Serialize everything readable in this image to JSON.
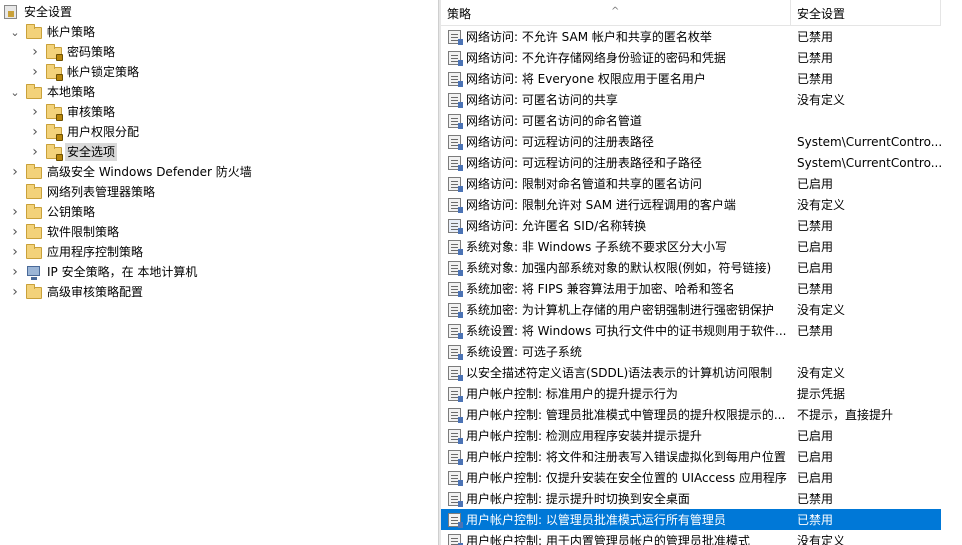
{
  "tree": {
    "root": {
      "label": "安全设置"
    },
    "items": [
      {
        "label": "帐户策略",
        "level": 1,
        "expander": "collapse",
        "icon": "folder"
      },
      {
        "label": "密码策略",
        "level": 2,
        "expander": "expand",
        "icon": "folder-lock"
      },
      {
        "label": "帐户锁定策略",
        "level": 2,
        "expander": "expand",
        "icon": "folder-lock"
      },
      {
        "label": "本地策略",
        "level": 1,
        "expander": "collapse",
        "icon": "folder"
      },
      {
        "label": "审核策略",
        "level": 2,
        "expander": "expand",
        "icon": "folder-lock"
      },
      {
        "label": "用户权限分配",
        "level": 2,
        "expander": "expand",
        "icon": "folder-lock"
      },
      {
        "label": "安全选项",
        "level": 2,
        "expander": "expand",
        "icon": "folder-lock",
        "selected": true
      },
      {
        "label": "高级安全 Windows Defender 防火墙",
        "level": 1,
        "expander": "expand",
        "icon": "folder"
      },
      {
        "label": "网络列表管理器策略",
        "level": 1,
        "expander": "none",
        "icon": "folder"
      },
      {
        "label": "公钥策略",
        "level": 1,
        "expander": "expand",
        "icon": "folder"
      },
      {
        "label": "软件限制策略",
        "level": 1,
        "expander": "expand",
        "icon": "folder"
      },
      {
        "label": "应用程序控制策略",
        "level": 1,
        "expander": "expand",
        "icon": "folder"
      },
      {
        "label": "IP 安全策略，在 本地计算机",
        "level": 1,
        "expander": "expand",
        "icon": "computer"
      },
      {
        "label": "高级审核策略配置",
        "level": 1,
        "expander": "expand",
        "icon": "folder"
      }
    ]
  },
  "list": {
    "columns": {
      "policy": "策略",
      "setting": "安全设置"
    },
    "rows": [
      {
        "policy": "网络访问: 不允许 SAM 帐户和共享的匿名枚举",
        "setting": "已禁用"
      },
      {
        "policy": "网络访问: 不允许存储网络身份验证的密码和凭据",
        "setting": "已禁用"
      },
      {
        "policy": "网络访问: 将 Everyone 权限应用于匿名用户",
        "setting": "已禁用"
      },
      {
        "policy": "网络访问: 可匿名访问的共享",
        "setting": "没有定义"
      },
      {
        "policy": "网络访问: 可匿名访问的命名管道",
        "setting": ""
      },
      {
        "policy": "网络访问: 可远程访问的注册表路径",
        "setting": "System\\CurrentContro..."
      },
      {
        "policy": "网络访问: 可远程访问的注册表路径和子路径",
        "setting": "System\\CurrentContro..."
      },
      {
        "policy": "网络访问: 限制对命名管道和共享的匿名访问",
        "setting": "已启用"
      },
      {
        "policy": "网络访问: 限制允许对 SAM 进行远程调用的客户端",
        "setting": "没有定义"
      },
      {
        "policy": "网络访问: 允许匿名 SID/名称转换",
        "setting": "已禁用",
        "alt": true
      },
      {
        "policy": "系统对象: 非 Windows 子系统不要求区分大小写",
        "setting": "已启用"
      },
      {
        "policy": "系统对象: 加强内部系统对象的默认权限(例如，符号链接)",
        "setting": "已启用"
      },
      {
        "policy": "系统加密: 将 FIPS 兼容算法用于加密、哈希和签名",
        "setting": "已禁用"
      },
      {
        "policy": "系统加密: 为计算机上存储的用户密钥强制进行强密钥保护",
        "setting": "没有定义"
      },
      {
        "policy": "系统设置: 将 Windows 可执行文件中的证书规则用于软件...",
        "setting": "已禁用"
      },
      {
        "policy": "系统设置: 可选子系统",
        "setting": ""
      },
      {
        "policy": "以安全描述符定义语言(SDDL)语法表示的计算机访问限制",
        "setting": "没有定义"
      },
      {
        "policy": "用户帐户控制: 标准用户的提升提示行为",
        "setting": "提示凭据"
      },
      {
        "policy": "用户帐户控制: 管理员批准模式中管理员的提升权限提示的...",
        "setting": "不提示，直接提升"
      },
      {
        "policy": "用户帐户控制: 检测应用程序安装并提示提升",
        "setting": "已启用"
      },
      {
        "policy": "用户帐户控制: 将文件和注册表写入错误虚拟化到每用户位置",
        "setting": "已启用"
      },
      {
        "policy": "用户帐户控制: 仅提升安装在安全位置的 UIAccess 应用程序",
        "setting": "已启用"
      },
      {
        "policy": "用户帐户控制: 提示提升时切换到安全桌面",
        "setting": "已禁用"
      },
      {
        "policy": "用户帐户控制: 以管理员批准模式运行所有管理员",
        "setting": "已禁用",
        "selected": true
      },
      {
        "policy": "用户帐户控制: 用于内置管理员帐户的管理员批准模式",
        "setting": "没有定义"
      }
    ]
  },
  "colors": {
    "selection": "#0078d7",
    "tree_selection": "#d9d9d9"
  }
}
